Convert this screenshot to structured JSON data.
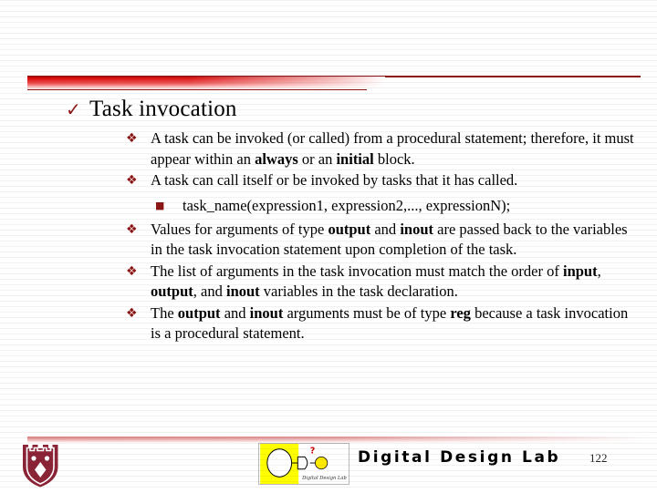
{
  "slide": {
    "title": {
      "bullet_glyph": "check-mark",
      "text": "Task invocation"
    },
    "accent_color": "#8c1515",
    "bullet_glyph": "diamond-cluster",
    "sub_bullet_glyph": "small-square",
    "bullets": [
      {
        "runs": [
          {
            "text": "A task can be invoked (or called) from a procedural statement; therefore, it must appear within an ",
            "bold": false
          },
          {
            "text": "always",
            "bold": true
          },
          {
            "text": " or an ",
            "bold": false
          },
          {
            "text": "initial",
            "bold": true
          },
          {
            "text": " block.",
            "bold": false
          }
        ]
      },
      {
        "runs": [
          {
            "text": "A task can call itself or be invoked by tasks that it has called.",
            "bold": false
          }
        ]
      },
      {
        "runs": [
          {
            "text": "Values for arguments of type ",
            "bold": false
          },
          {
            "text": "output",
            "bold": true
          },
          {
            "text": " and ",
            "bold": false
          },
          {
            "text": "inout",
            "bold": true
          },
          {
            "text": " are passed back to the variables in the task invocation statement upon completion of the task.",
            "bold": false
          }
        ]
      },
      {
        "runs": [
          {
            "text": "The list of arguments in the task invocation must match the order of ",
            "bold": false
          },
          {
            "text": "input",
            "bold": true
          },
          {
            "text": ", ",
            "bold": false
          },
          {
            "text": "output",
            "bold": true
          },
          {
            "text": ", and ",
            "bold": false
          },
          {
            "text": "inout",
            "bold": true
          },
          {
            "text": " variables in the task declaration.",
            "bold": false
          }
        ]
      },
      {
        "runs": [
          {
            "text": "The ",
            "bold": false
          },
          {
            "text": "output",
            "bold": true
          },
          {
            "text": " and ",
            "bold": false
          },
          {
            "text": "inout",
            "bold": true
          },
          {
            "text": " arguments must be of type ",
            "bold": false
          },
          {
            "text": "reg",
            "bold": true
          },
          {
            "text": " because a task invocation is a procedural statement.",
            "bold": false
          }
        ]
      }
    ],
    "sub_bullet": {
      "after_bullet_index": 1,
      "text": "task_name(expression1, expression2,..., expressionN);"
    }
  },
  "footer": {
    "lab_name": "Digital Design Lab",
    "logo_caption": "Digital Design Lab",
    "logo_question_mark": "?",
    "page_number": "122",
    "shield_color": "#8c2437",
    "logo_yellow": "#ffff00"
  }
}
